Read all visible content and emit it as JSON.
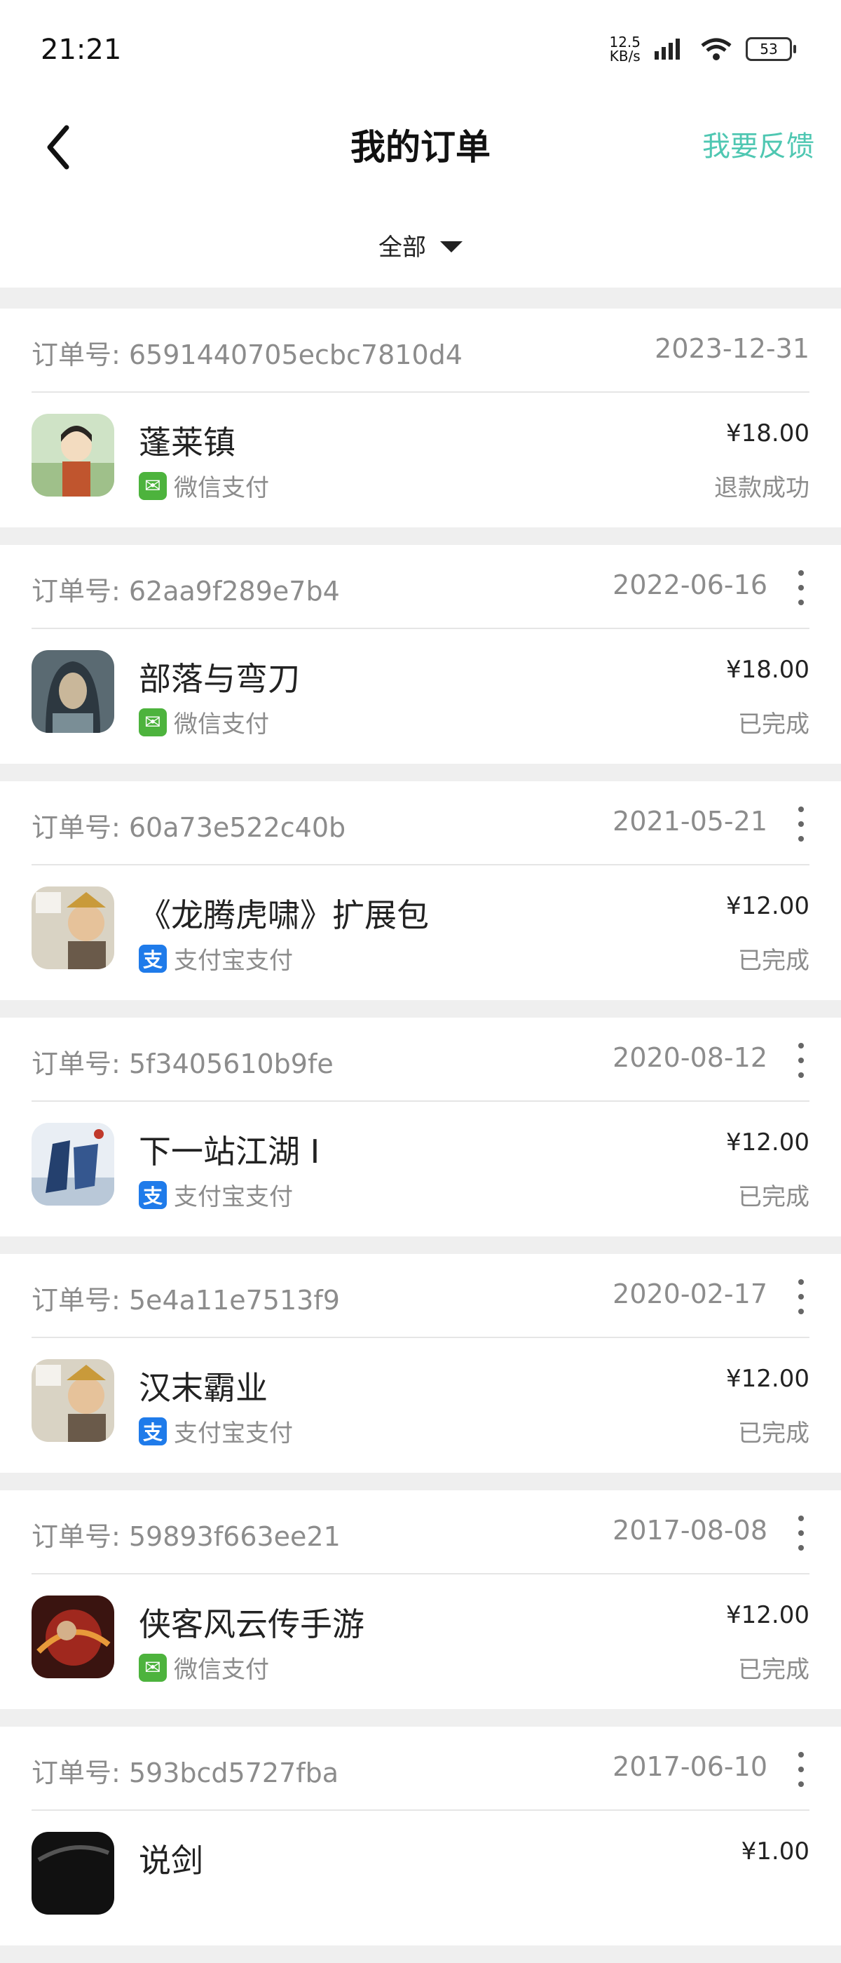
{
  "status_bar": {
    "time": "21:21",
    "net_speed_value": "12.5",
    "net_speed_unit": "KB/s",
    "battery": "53"
  },
  "header": {
    "title": "我的订单",
    "feedback_label": "我要反馈"
  },
  "filter": {
    "selected": "全部"
  },
  "orders": [
    {
      "order_no": "订单号: 6591440705ecbc7810d4",
      "date": "2023-12-31",
      "game": "蓬莱镇",
      "payment": "微信支付",
      "payment_type": "wechat",
      "price": "¥18.00",
      "status": "退款成功",
      "menu": false
    },
    {
      "order_no": "订单号: 62aa9f289e7b4",
      "date": "2022-06-16",
      "game": "部落与弯刀",
      "payment": "微信支付",
      "payment_type": "wechat",
      "price": "¥18.00",
      "status": "已完成",
      "menu": true
    },
    {
      "order_no": "订单号: 60a73e522c40b",
      "date": "2021-05-21",
      "game": "《龙腾虎啸》扩展包",
      "payment": "支付宝支付",
      "payment_type": "alipay",
      "price": "¥12.00",
      "status": "已完成",
      "menu": true
    },
    {
      "order_no": "订单号: 5f3405610b9fe",
      "date": "2020-08-12",
      "game": "下一站江湖 I",
      "payment": "支付宝支付",
      "payment_type": "alipay",
      "price": "¥12.00",
      "status": "已完成",
      "menu": true
    },
    {
      "order_no": "订单号: 5e4a11e7513f9",
      "date": "2020-02-17",
      "game": "汉末霸业",
      "payment": "支付宝支付",
      "payment_type": "alipay",
      "price": "¥12.00",
      "status": "已完成",
      "menu": true
    },
    {
      "order_no": "订单号: 59893f663ee21",
      "date": "2017-08-08",
      "game": "侠客风云传手游",
      "payment": "微信支付",
      "payment_type": "wechat",
      "price": "¥12.00",
      "status": "已完成",
      "menu": true
    },
    {
      "order_no": "订单号: 593bcd5727fba",
      "date": "2017-06-10",
      "game": "说剑",
      "payment": "",
      "payment_type": "",
      "price": "¥1.00",
      "status": "",
      "menu": true
    }
  ]
}
